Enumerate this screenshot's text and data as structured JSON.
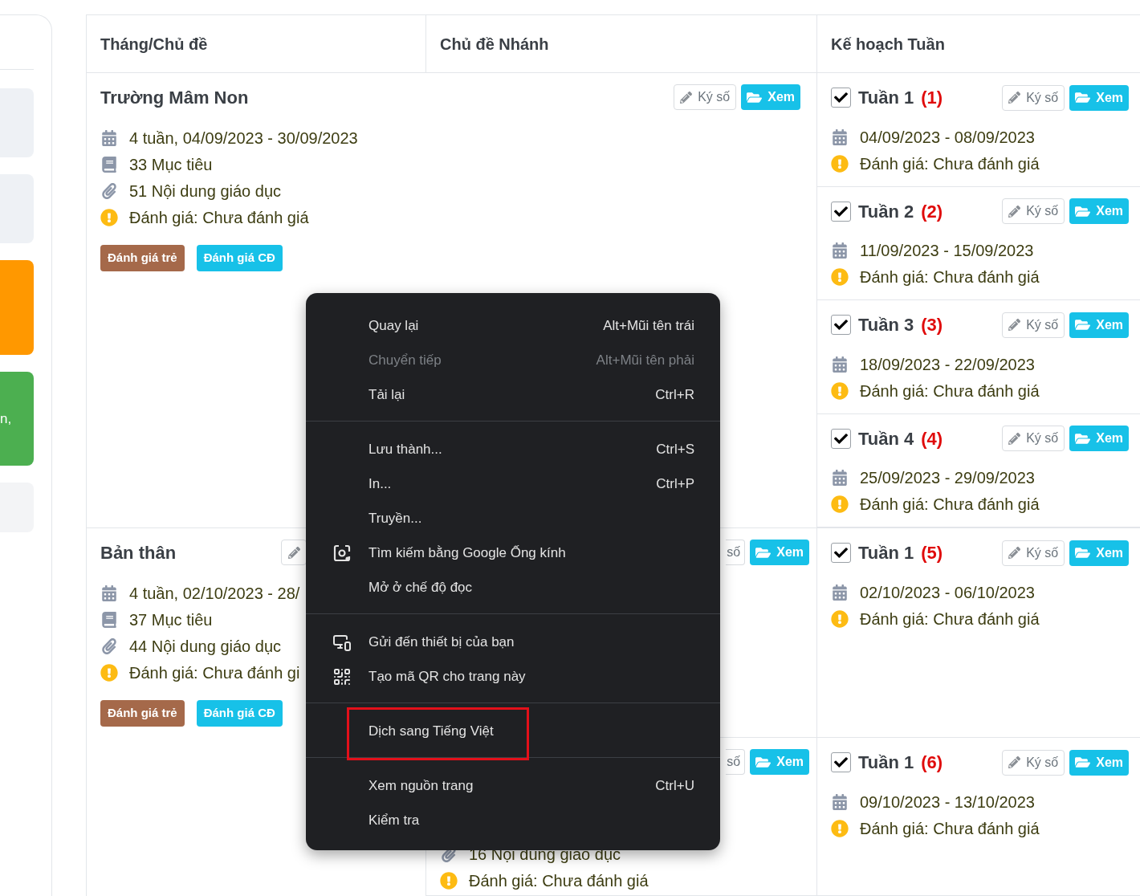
{
  "sidebar": {
    "tiles": [
      {
        "color": "#eef1f5"
      },
      {
        "color": "#eef1f5"
      },
      {
        "color": "#ff9800"
      },
      {
        "color": "#4caf50",
        "text": "n,"
      },
      {
        "color": "#f3f4f6"
      }
    ]
  },
  "table": {
    "columns": [
      "Tháng/Chủ đề",
      "Chủ đề Nhánh",
      "Kế hoạch Tuần"
    ],
    "months": [
      {
        "title": "Trường Mâm Non",
        "buttons": [
          {
            "kind": "sign",
            "label": "Ký số"
          },
          {
            "kind": "view",
            "label": "Xem"
          }
        ],
        "details": [
          {
            "kind": "period",
            "text": "4 tuần, 04/09/2023 - 30/09/2023"
          },
          {
            "kind": "goals",
            "text": "33 Mục tiêu"
          },
          {
            "kind": "contents",
            "text": "51 Nội dung giáo dục"
          },
          {
            "kind": "status",
            "text": "Đánh giá: Chưa đánh giá"
          }
        ],
        "badges": [
          {
            "label": "Đánh giá trẻ",
            "color": "#a5694a"
          },
          {
            "label": "Đánh giá CĐ",
            "color": "#17c1e8"
          }
        ],
        "weeks": [
          {
            "title": "Tuần 1",
            "number": "(1)",
            "checked": true,
            "sign": "Ký số",
            "view": "Xem",
            "dates": "04/09/2023 - 08/09/2023",
            "status": "Đánh giá: Chưa đánh giá"
          },
          {
            "title": "Tuần 2",
            "number": "(2)",
            "checked": true,
            "sign": "Ký số",
            "view": "Xem",
            "dates": "11/09/2023 - 15/09/2023",
            "status": "Đánh giá: Chưa đánh giá"
          },
          {
            "title": "Tuần 3",
            "number": "(3)",
            "checked": true,
            "sign": "Ký số",
            "view": "Xem",
            "dates": "18/09/2023 - 22/09/2023",
            "status": "Đánh giá: Chưa đánh giá"
          },
          {
            "title": "Tuần 4",
            "number": "(4)",
            "checked": true,
            "sign": "Ký số",
            "view": "Xem",
            "dates": "25/09/2023 - 29/09/2023",
            "status": "Đánh giá: Chưa đánh giá"
          }
        ]
      },
      {
        "title": "Bản thân",
        "buttons": [
          {
            "kind": "sign_icon"
          }
        ],
        "details": [
          {
            "kind": "period",
            "text": "4 tuần, 02/10/2023 - 28/"
          },
          {
            "kind": "goals",
            "text": "37 Mục tiêu"
          },
          {
            "kind": "contents",
            "text": "44 Nội dung giáo dục"
          },
          {
            "kind": "status",
            "text": "Đánh giá: Chưa đánh gi"
          }
        ],
        "badges": [
          {
            "label": "Đánh giá trẻ",
            "color": "#a5694a"
          },
          {
            "label": "Đánh giá CĐ",
            "color": "#17c1e8"
          }
        ],
        "subtopics": [
          {
            "buttons": [
              {
                "kind": "sign_text",
                "label": "số"
              },
              {
                "kind": "view",
                "label": "Xem"
              }
            ],
            "weeks": [
              {
                "title": "Tuần 1",
                "number": "(5)",
                "checked": true,
                "sign": "Ký số",
                "view": "Xem",
                "dates": "02/10/2023 - 06/10/2023",
                "status": "Đánh giá: Chưa đánh giá"
              }
            ]
          },
          {
            "buttons": [
              {
                "kind": "sign_text",
                "label": "số"
              },
              {
                "kind": "view",
                "label": "Xem"
              }
            ],
            "details": [
              {
                "kind": "contents",
                "text": "16 Nội dung giáo dục"
              },
              {
                "kind": "status",
                "text": "Đánh giá: Chưa đánh giá"
              }
            ],
            "weeks": [
              {
                "title": "Tuần 1",
                "number": "(6)",
                "checked": true,
                "sign": "Ký số",
                "view": "Xem",
                "dates": "09/10/2023 - 13/10/2023",
                "status": "Đánh giá: Chưa đánh giá"
              }
            ]
          }
        ]
      }
    ]
  },
  "context_menu": {
    "groups": [
      {
        "items": [
          {
            "label": "Quay lại",
            "shortcut": "Alt+Mũi tên trái",
            "disabled": false,
            "highlighted": false
          },
          {
            "label": "Chuyển tiếp",
            "shortcut": "Alt+Mũi tên phải",
            "disabled": true,
            "highlighted": false
          },
          {
            "label": "Tải lại",
            "shortcut": "Ctrl+R",
            "disabled": false,
            "highlighted": false
          }
        ]
      },
      {
        "items": [
          {
            "label": "Lưu thành...",
            "shortcut": "Ctrl+S",
            "disabled": false,
            "highlighted": false
          },
          {
            "label": "In...",
            "shortcut": "Ctrl+P",
            "disabled": false,
            "highlighted": false
          },
          {
            "label": "Truyền...",
            "disabled": false,
            "highlighted": false
          },
          {
            "label": "Tìm kiếm bằng Google Ống kính",
            "kind": "lens",
            "disabled": false,
            "highlighted": false
          },
          {
            "label": "Mở ở chế độ đọc",
            "disabled": false,
            "highlighted": false
          }
        ]
      },
      {
        "items": [
          {
            "label": "Gửi đến thiết bị của bạn",
            "kind": "devices",
            "disabled": false,
            "highlighted": false
          },
          {
            "label": "Tạo mã QR cho trang này",
            "kind": "qr",
            "disabled": false,
            "highlighted": false
          }
        ]
      },
      {
        "items": [
          {
            "label": "Dịch sang Tiếng Việt",
            "disabled": false,
            "highlighted": true
          }
        ]
      },
      {
        "items": [
          {
            "label": "Xem nguồn trang",
            "shortcut": "Ctrl+U",
            "disabled": false,
            "highlighted": false
          },
          {
            "label": "Kiểm tra",
            "disabled": false,
            "highlighted": false
          }
        ]
      }
    ]
  }
}
